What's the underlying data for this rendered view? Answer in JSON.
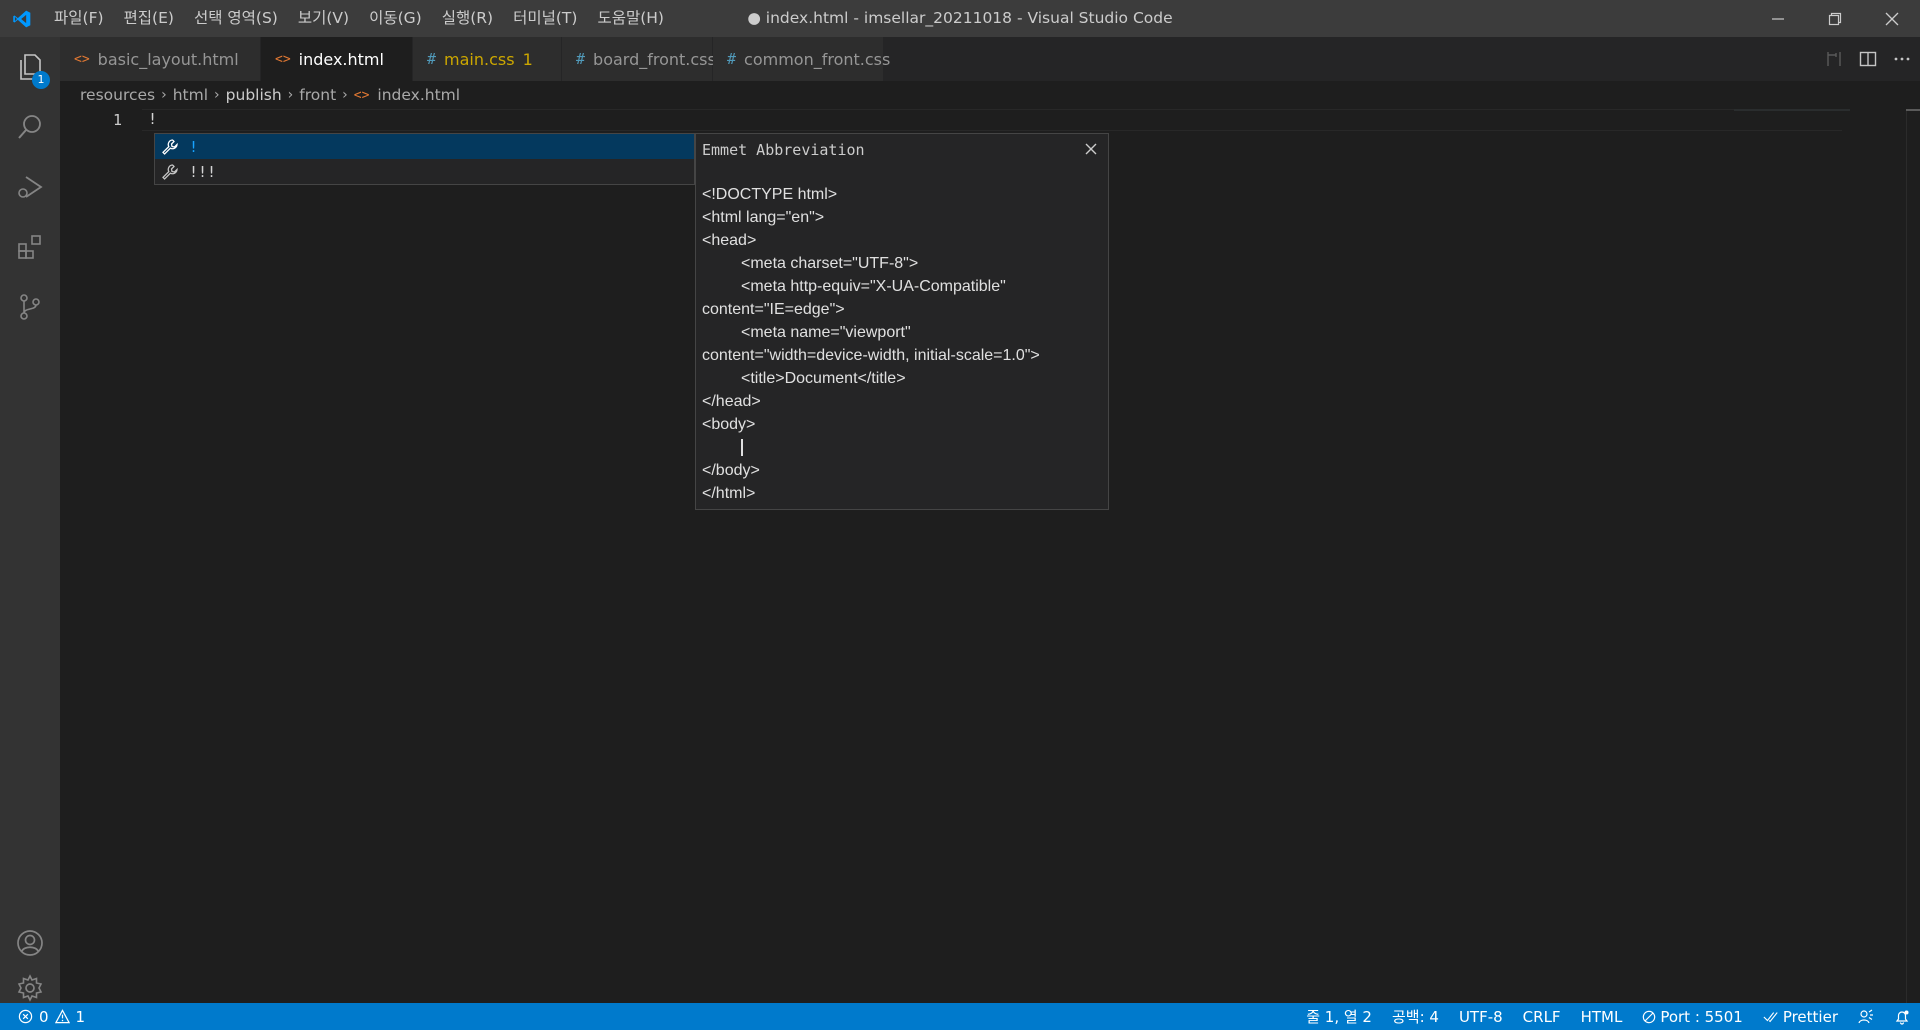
{
  "window": {
    "title": "● index.html - imsellar_20211018 - Visual Studio Code",
    "logo_icon": "vscode-logo-icon",
    "controls": [
      "minimize-icon",
      "restore-icon",
      "close-icon"
    ]
  },
  "menu": {
    "file": "파일(F)",
    "edit": "편집(E)",
    "selection": "선택 영역(S)",
    "view": "보기(V)",
    "go": "이동(G)",
    "run": "실행(R)",
    "terminal": "터미널(T)",
    "help": "도움말(H)"
  },
  "activity": {
    "explorer_badge": "1",
    "icons": [
      "files-icon",
      "search-icon",
      "run-debug-icon",
      "extensions-icon",
      "source-control-icon",
      "account-icon",
      "gear-icon"
    ]
  },
  "tabs": [
    {
      "label": "basic_layout.html",
      "icon": "<>",
      "kind": "html"
    },
    {
      "label": "index.html",
      "icon": "<>",
      "kind": "html"
    },
    {
      "label": "main.css",
      "icon": "#",
      "kind": "css",
      "count": "1"
    },
    {
      "label": "board_front.css",
      "icon": "#",
      "kind": "css"
    },
    {
      "label": "common_front.css",
      "icon": "#",
      "kind": "css"
    }
  ],
  "breadcrumb": {
    "c1": "resources",
    "c2": "html",
    "c3": "publish",
    "c4": "front",
    "file_icon": "<>",
    "c5": "index.html"
  },
  "editor": {
    "line_number": "1",
    "line_text": "!"
  },
  "suggest": {
    "items": [
      {
        "label": "!"
      },
      {
        "label": "!!!"
      }
    ]
  },
  "details": {
    "title": "Emmet Abbreviation",
    "lines": [
      "<!DOCTYPE html>",
      "<html lang=\"en\">",
      "<head>",
      "<meta charset=\"UTF-8\">",
      "<meta http-equiv=\"X-UA-Compatible\"",
      "content=\"IE=edge\">",
      "<meta name=\"viewport\"",
      "content=\"width=device-width, initial-scale=1.0\">",
      "<title>Document</title>",
      "</head>",
      "<body>",
      "</body>",
      "</html>"
    ]
  },
  "status": {
    "errors": "0",
    "warnings": "1",
    "position": "줄 1, 열 2",
    "spaces": "공백: 4",
    "encoding": "UTF-8",
    "eol": "CRLF",
    "language": "HTML",
    "port": "Port : 5501",
    "prettier": "Prettier"
  },
  "colors": {
    "accent": "#007acc",
    "titlebar": "#3c3c3c",
    "activitybar": "#333333",
    "editor": "#1e1e1e",
    "html_icon": "#e37933",
    "css_icon": "#519aba",
    "warning": "#cca700",
    "suggest_selected": "#04395e",
    "suggest_highlight": "#18a3ff"
  }
}
